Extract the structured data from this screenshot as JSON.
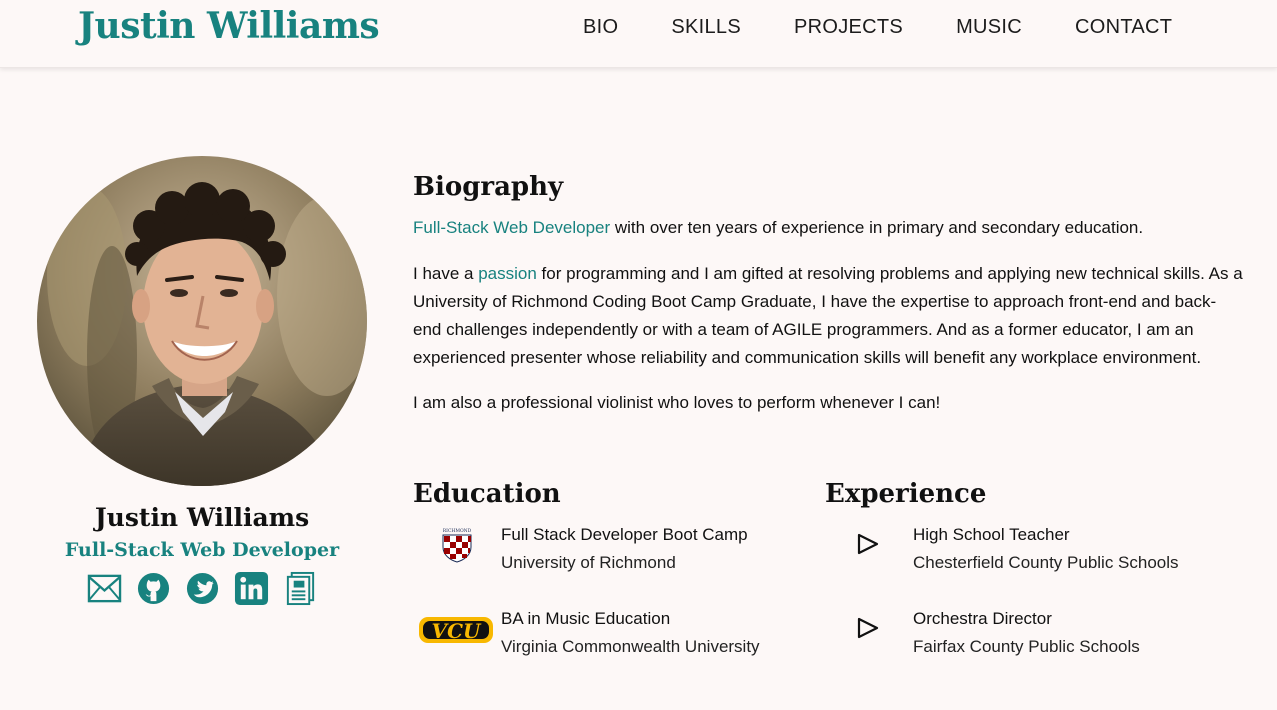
{
  "site": {
    "brand": "Justin Williams"
  },
  "nav": {
    "items": [
      "BIO",
      "SKILLS",
      "PROJECTS",
      "MUSIC",
      "CONTACT"
    ]
  },
  "profile": {
    "name": "Justin Williams",
    "title": "Full-Stack Web Developer",
    "socials": [
      "email-icon",
      "github-icon",
      "twitter-icon",
      "linkedin-icon",
      "cv-icon"
    ]
  },
  "bio": {
    "heading": "Biography",
    "p1_highlight": "Full-Stack Web Developer",
    "p1_rest": " with over ten years of experience in primary and secondary education.",
    "p2_start": "I have a ",
    "p2_highlight": "passion",
    "p2_rest": " for programming and I am gifted at resolving problems and applying new technical skills. As a University of Richmond Coding Boot Camp Graduate, I have the expertise to approach front-end and back-end challenges independently or with a team of AGILE programmers. And as a former educator, I am an experienced presenter whose reliability and communication skills will benefit any workplace environment.",
    "p3": "I am also a professional violinist who loves to perform whenever I can!"
  },
  "education": {
    "heading": "Education",
    "items": [
      {
        "title": "Full Stack Developer Boot Camp",
        "subtitle": "University of Richmond",
        "logo": "richmond-shield-logo",
        "logo_text": "RICHMOND"
      },
      {
        "title": "BA in Music Education",
        "subtitle": "Virginia Commonwealth University",
        "logo": "vcu-logo",
        "logo_text": "VCU"
      }
    ]
  },
  "experience": {
    "heading": "Experience",
    "items": [
      {
        "title": "High School Teacher",
        "subtitle": "Chesterfield County Public Schools",
        "icon": "play-triangle-icon"
      },
      {
        "title": "Orchestra Director",
        "subtitle": "Fairfax County Public Schools",
        "icon": "play-triangle-icon"
      }
    ]
  },
  "colors": {
    "accent": "#18827f",
    "background": "#fdf8f7",
    "text": "#111111"
  }
}
